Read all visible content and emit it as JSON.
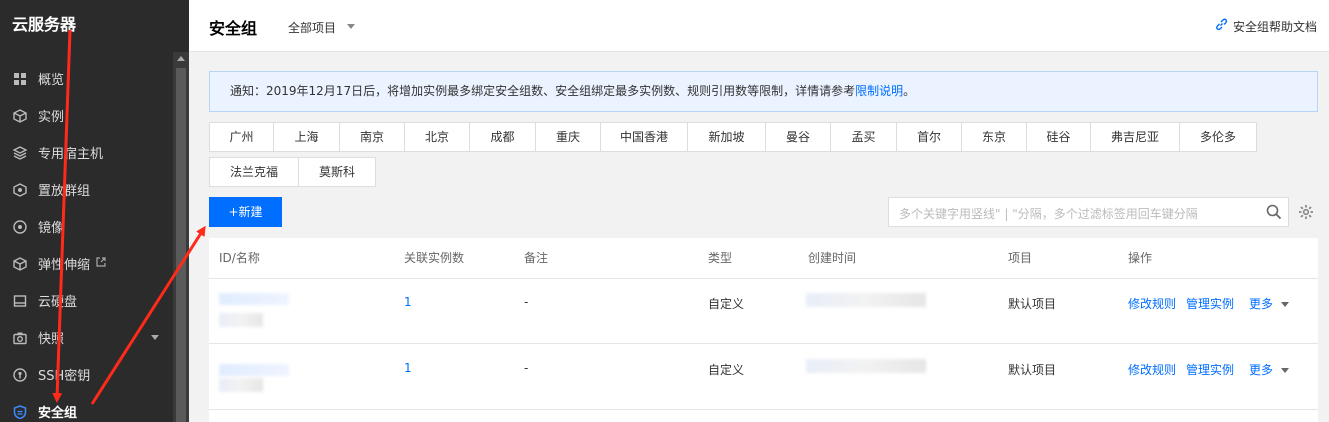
{
  "sidebar": {
    "title": "云服务器",
    "items": [
      {
        "label": "概览",
        "icon": "grid-icon"
      },
      {
        "label": "实例",
        "icon": "cube-icon"
      },
      {
        "label": "专用宿主机",
        "icon": "layers-icon"
      },
      {
        "label": "置放群组",
        "icon": "hexagon-icon"
      },
      {
        "label": "镜像",
        "icon": "disc-icon"
      },
      {
        "label": "弹性伸缩",
        "icon": "scale-cube-icon",
        "external": true
      },
      {
        "label": "云硬盘",
        "icon": "disk-icon"
      },
      {
        "label": "快照",
        "icon": "camera-icon",
        "expandable": true
      },
      {
        "label": "SSH密钥",
        "icon": "key-icon"
      },
      {
        "label": "安全组",
        "icon": "shield-icon",
        "active": true
      }
    ]
  },
  "header": {
    "title": "安全组",
    "project": "全部项目",
    "help": "安全组帮助文档"
  },
  "notice": {
    "text": "通知：2019年12月17日后，将增加实例最多绑定安全组数、安全组绑定最多实例数、规则引用数等限制，详情请参考",
    "link": "限制说明",
    "suffix": "。"
  },
  "regions": [
    "广州",
    "上海",
    "南京",
    "北京",
    "成都",
    "重庆",
    "中国香港",
    "新加坡",
    "曼谷",
    "孟买",
    "首尔",
    "东京",
    "硅谷",
    "弗吉尼亚",
    "多伦多",
    "法兰克福",
    "莫斯科"
  ],
  "toolbar": {
    "new_label": "+新建",
    "search_placeholder": "多个关键字用竖线\" | \"分隔，多个过滤标签用回车键分隔"
  },
  "table": {
    "columns": [
      "ID/名称",
      "关联实例数",
      "备注",
      "类型",
      "创建时间",
      "项目",
      "操作"
    ],
    "rows": [
      {
        "instances": "1",
        "remark": "-",
        "type": "自定义",
        "project": "默认项目",
        "action1": "修改规则",
        "action2": "管理实例",
        "more": "更多"
      },
      {
        "instances": "1",
        "remark": "-",
        "type": "自定义",
        "project": "默认项目",
        "action1": "修改规则",
        "action2": "管理实例",
        "more": "更多"
      }
    ]
  },
  "colors": {
    "sidebar_bg": "#2b2b2b",
    "accent": "#006eff",
    "annotation": "#ff2a1a"
  }
}
